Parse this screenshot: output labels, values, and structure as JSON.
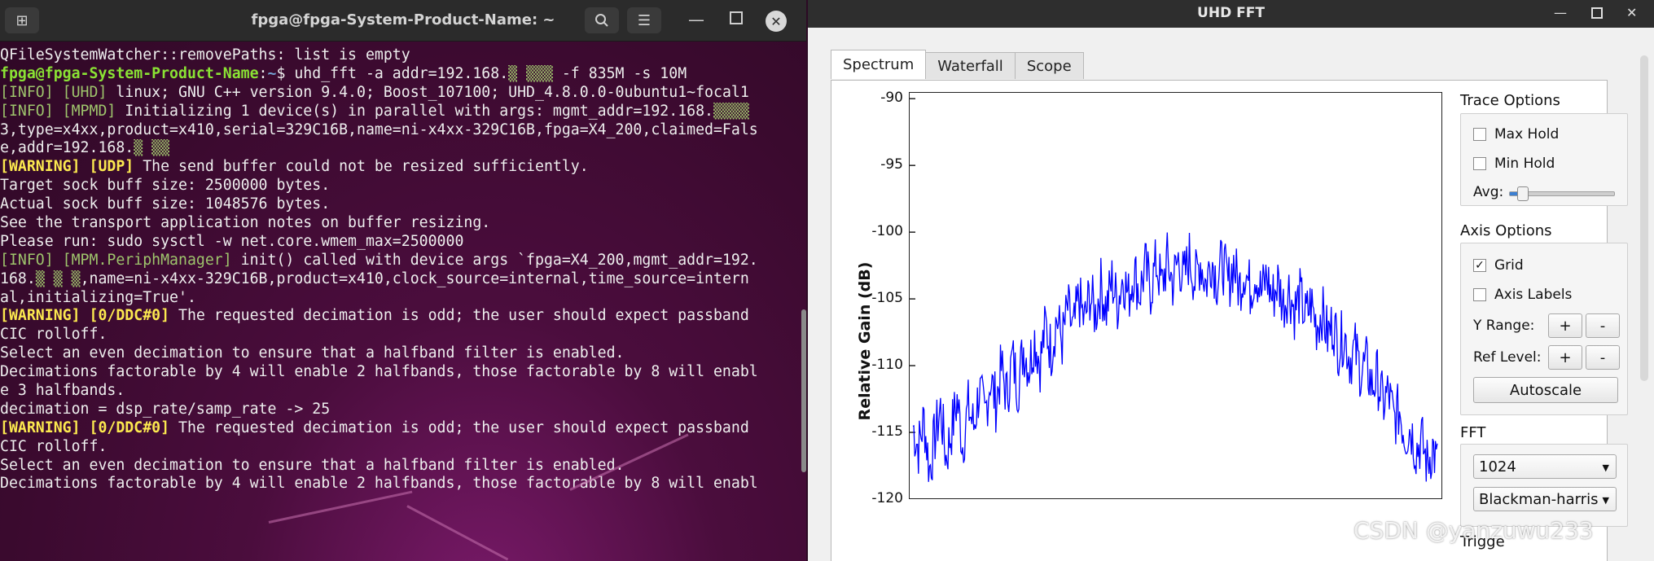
{
  "terminal": {
    "title": "fpga@fpga-System-Product-Name: ~",
    "lines": [
      [
        {
          "t": "QFileSystemWatcher::removePaths: list is empty",
          "c": ""
        }
      ],
      [
        {
          "t": "fpga@fpga-System-Product-Name",
          "c": "green"
        },
        {
          "t": ":",
          "c": ""
        },
        {
          "t": "~",
          "c": "blue"
        },
        {
          "t": "$ uhd_fft -a addr=192.168.",
          "c": ""
        },
        {
          "t": "▒ ▒▒▒",
          "c": "dim"
        },
        {
          "t": " -f 835M -s 10M",
          "c": ""
        }
      ],
      [
        {
          "t": "[INFO] [UHD]",
          "c": "dim"
        },
        {
          "t": " linux; GNU C++ version 9.4.0; Boost_107100; UHD_4.8.0.0-0ubuntu1~focal1",
          "c": ""
        }
      ],
      [
        {
          "t": "[INFO] [MPMD]",
          "c": "dim"
        },
        {
          "t": " Initializing 1 device(s) in parallel with args: mgmt_addr=192.168.",
          "c": ""
        },
        {
          "t": "▒▒▒▒",
          "c": "dim"
        }
      ],
      [
        {
          "t": "3,type=x4xx,product=x410,serial=329C16B,name=ni-x4xx-329C16B,fpga=X4_200,claimed=Fals",
          "c": ""
        }
      ],
      [
        {
          "t": "e,addr=192.168.",
          "c": ""
        },
        {
          "t": "▒ ▒▒",
          "c": "dim"
        }
      ],
      [
        {
          "t": "[WARNING] [UDP]",
          "c": "warn"
        },
        {
          "t": " The send buffer could not be resized sufficiently.",
          "c": ""
        }
      ],
      [
        {
          "t": "Target sock buff size: 2500000 bytes.",
          "c": ""
        }
      ],
      [
        {
          "t": "Actual sock buff size: 1048576 bytes.",
          "c": ""
        }
      ],
      [
        {
          "t": "See the transport application notes on buffer resizing.",
          "c": ""
        }
      ],
      [
        {
          "t": "Please run: sudo sysctl -w net.core.wmem_max=2500000",
          "c": ""
        }
      ],
      [
        {
          "t": "[INFO] [MPM.PeriphManager]",
          "c": "dim"
        },
        {
          "t": " init() called with device args `fpga=X4_200,mgmt_addr=192.",
          "c": ""
        }
      ],
      [
        {
          "t": "168.",
          "c": ""
        },
        {
          "t": "▒ ▒ ▒",
          "c": "dim"
        },
        {
          "t": ",name=ni-x4xx-329C16B,product=x410,clock_source=internal,time_source=intern",
          "c": ""
        }
      ],
      [
        {
          "t": "al,initializing=True'.",
          "c": ""
        }
      ],
      [
        {
          "t": "[WARNING] [0/DDC#0]",
          "c": "warn"
        },
        {
          "t": " The requested decimation is odd; the user should expect passband",
          "c": ""
        }
      ],
      [
        {
          "t": "CIC rolloff.",
          "c": ""
        }
      ],
      [
        {
          "t": "Select an even decimation to ensure that a halfband filter is enabled.",
          "c": ""
        }
      ],
      [
        {
          "t": "Decimations factorable by 4 will enable 2 halfbands, those factorable by 8 will enabl",
          "c": ""
        }
      ],
      [
        {
          "t": "e 3 halfbands.",
          "c": ""
        }
      ],
      [
        {
          "t": "decimation = dsp_rate/samp_rate -> 25",
          "c": ""
        }
      ],
      [
        {
          "t": "[WARNING] [0/DDC#0]",
          "c": "warn"
        },
        {
          "t": " The requested decimation is odd; the user should expect passband",
          "c": ""
        }
      ],
      [
        {
          "t": "CIC rolloff.",
          "c": ""
        }
      ],
      [
        {
          "t": "Select an even decimation to ensure that a halfband filter is enabled.",
          "c": ""
        }
      ],
      [
        {
          "t": "Decimations factorable by 4 will enable 2 halfbands, those factorable by 8 will enabl",
          "c": ""
        }
      ]
    ]
  },
  "fft": {
    "title": "UHD FFT",
    "tabs": [
      "Spectrum",
      "Waterfall",
      "Scope"
    ],
    "active_tab": "Spectrum",
    "trace_options": {
      "title": "Trace Options",
      "max_hold": "Max Hold",
      "min_hold": "Min Hold",
      "avg_label": "Avg:",
      "avg_level": 0.1
    },
    "axis_options": {
      "title": "Axis Options",
      "grid": "Grid",
      "grid_checked": "✓",
      "axis_labels": "Axis Labels",
      "y_range": "Y Range:",
      "ref_level": "Ref Level:",
      "plus": "+",
      "minus": "-",
      "autoscale": "Autoscale"
    },
    "fft_options": {
      "title": "FFT",
      "size": "1024",
      "window": "Blackman-harris"
    },
    "trigger_title": "Trigge",
    "watermark": "CSDN @yanzuwu233"
  },
  "chart_data": {
    "type": "line",
    "ylabel": "Relative Gain (dB)",
    "xlabel": "",
    "title": "",
    "yticks": [
      -90,
      -95,
      -100,
      -105,
      -110,
      -115,
      -120
    ],
    "ylim": [
      -120,
      -89.5
    ],
    "grid": false,
    "color": "#0000ff",
    "series": [
      {
        "values": [
          -114.5,
          -116.2,
          -114.0,
          -117.8,
          -115.3,
          -113.2,
          -116.9,
          -114.8,
          -112.6,
          -115.9,
          -113.1,
          -114.6,
          -111.8,
          -113.9,
          -110.9,
          -112.8,
          -110.2,
          -112.3,
          -109.4,
          -111.6,
          -108.6,
          -110.1,
          -107.9,
          -109.8,
          -107.0,
          -108.9,
          -106.4,
          -108.2,
          -105.7,
          -107.6,
          -104.9,
          -106.8,
          -104.6,
          -106.2,
          -104.0,
          -105.8,
          -103.6,
          -105.4,
          -103.2,
          -104.9,
          -102.8,
          -104.6,
          -102.6,
          -104.3,
          -102.3,
          -104.1,
          -102.1,
          -103.8,
          -102.0,
          -103.6,
          -101.8,
          -103.7,
          -102.1,
          -103.9,
          -101.9,
          -103.6,
          -102.2,
          -104.0,
          -102.3,
          -104.2,
          -102.7,
          -104.3,
          -102.9,
          -104.6,
          -103.3,
          -105.0,
          -103.7,
          -105.4,
          -104.2,
          -105.9,
          -104.8,
          -106.4,
          -105.3,
          -107.0,
          -105.9,
          -107.8,
          -106.8,
          -108.6,
          -107.6,
          -109.5,
          -108.8,
          -110.4,
          -109.9,
          -111.6,
          -110.8,
          -112.9,
          -112.0,
          -114.1,
          -113.3,
          -115.2,
          -114.6,
          -116.3,
          -115.6,
          -117.4,
          -116.1,
          -117.8
        ]
      }
    ]
  }
}
